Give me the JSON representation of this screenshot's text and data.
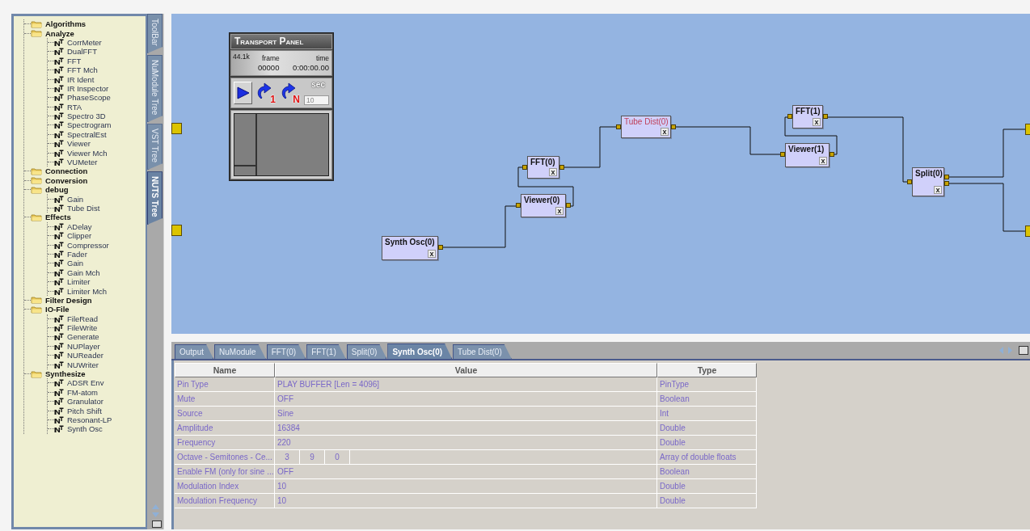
{
  "tool_tabs": [
    {
      "label": "ToolBar",
      "selected": false
    },
    {
      "label": "NuModule Tree",
      "selected": false
    },
    {
      "label": "VST Tree",
      "selected": false
    },
    {
      "label": "NUTS Tree",
      "selected": true
    }
  ],
  "module_tree": [
    {
      "label": "Algorithms",
      "kind": "folder"
    },
    {
      "label": "Analyze",
      "kind": "folder",
      "children": [
        {
          "label": "CorrMeter",
          "kind": "module"
        },
        {
          "label": "DualFFT",
          "kind": "module"
        },
        {
          "label": "FFT",
          "kind": "module"
        },
        {
          "label": "FFT Mch",
          "kind": "module"
        },
        {
          "label": "IR Ident",
          "kind": "module"
        },
        {
          "label": "IR Inspector",
          "kind": "module"
        },
        {
          "label": "PhaseScope",
          "kind": "module"
        },
        {
          "label": "RTA",
          "kind": "module"
        },
        {
          "label": "Spectro 3D",
          "kind": "module"
        },
        {
          "label": "Spectrogram",
          "kind": "module"
        },
        {
          "label": "SpectralEst",
          "kind": "module"
        },
        {
          "label": "Viewer",
          "kind": "module"
        },
        {
          "label": "Viewer Mch",
          "kind": "module"
        },
        {
          "label": "VUMeter",
          "kind": "module"
        }
      ]
    },
    {
      "label": "Connection",
      "kind": "folder"
    },
    {
      "label": "Conversion",
      "kind": "folder"
    },
    {
      "label": "debug",
      "kind": "folder",
      "children": [
        {
          "label": "Gain",
          "kind": "module"
        },
        {
          "label": "Tube Dist",
          "kind": "module"
        }
      ]
    },
    {
      "label": "Effects",
      "kind": "folder",
      "children": [
        {
          "label": "ADelay",
          "kind": "module"
        },
        {
          "label": "Clipper",
          "kind": "module"
        },
        {
          "label": "Compressor",
          "kind": "module"
        },
        {
          "label": "Fader",
          "kind": "module"
        },
        {
          "label": "Gain",
          "kind": "module"
        },
        {
          "label": "Gain Mch",
          "kind": "module"
        },
        {
          "label": "Limiter",
          "kind": "module"
        },
        {
          "label": "Limiter Mch",
          "kind": "module"
        }
      ]
    },
    {
      "label": "Filter Design",
      "kind": "folder"
    },
    {
      "label": "IO-File",
      "kind": "folder",
      "children": [
        {
          "label": "FileRead",
          "kind": "module"
        },
        {
          "label": "FileWrite",
          "kind": "module"
        },
        {
          "label": "Generate",
          "kind": "module"
        },
        {
          "label": "NUPlayer",
          "kind": "module"
        },
        {
          "label": "NUReader",
          "kind": "module"
        },
        {
          "label": "NUWriter",
          "kind": "module"
        }
      ]
    },
    {
      "label": "Synthesize",
      "kind": "folder",
      "children": [
        {
          "label": "ADSR Env",
          "kind": "module"
        },
        {
          "label": "FM-atom",
          "kind": "module"
        },
        {
          "label": "Granulator",
          "kind": "module"
        },
        {
          "label": "Pitch Shift",
          "kind": "module"
        },
        {
          "label": "Resonant-LP",
          "kind": "module"
        },
        {
          "label": "Synth Osc",
          "kind": "module"
        }
      ]
    }
  ],
  "transport_panel": {
    "title": "Transport Panel",
    "sample_rate": "44.1k",
    "frame_label": "frame",
    "frame": "00000",
    "time_label": "time",
    "time": "0:00:00.00",
    "buttons": [
      {
        "kind": "play"
      },
      {
        "kind": "loop",
        "badge": "1"
      },
      {
        "kind": "loop",
        "badge": "N"
      }
    ],
    "duration_label": "sec",
    "duration": "10"
  },
  "nodes": [
    {
      "label": "Tube Dist(0)",
      "highlighted": true,
      "close": "x"
    },
    {
      "label": "FFT(1)",
      "highlighted": false,
      "close": "x"
    },
    {
      "label": "Viewer(1)",
      "highlighted": false,
      "close": "x"
    },
    {
      "label": "FFT(0)",
      "highlighted": false,
      "close": "x"
    },
    {
      "label": "Split(0)",
      "highlighted": false,
      "close": "x"
    },
    {
      "label": "Viewer(0)",
      "highlighted": false,
      "close": "x"
    },
    {
      "label": "Synth Osc(0)",
      "highlighted": false,
      "close": "x"
    }
  ],
  "property_tabs": [
    {
      "label": "Output",
      "selected": false
    },
    {
      "label": "NuModule",
      "selected": false
    },
    {
      "label": "FFT(0)",
      "selected": false
    },
    {
      "label": "FFT(1)",
      "selected": false
    },
    {
      "label": "Split(0)",
      "selected": false
    },
    {
      "label": "Synth Osc(0)",
      "selected": true
    },
    {
      "label": "Tube Dist(0)",
      "selected": false
    }
  ],
  "property_table": {
    "columns": [
      "Name",
      "Value",
      "Type"
    ],
    "rows": [
      {
        "name": "Pin Type",
        "kind": "text",
        "value": "PLAY BUFFER [Len = 4096]",
        "type": "PinType"
      },
      {
        "name": "Mute",
        "kind": "text",
        "value": "OFF",
        "type": "Boolean"
      },
      {
        "name": "Source",
        "kind": "text",
        "value": "Sine",
        "type": "Int"
      },
      {
        "name": "Amplitude",
        "kind": "text",
        "value": "16384",
        "type": "Double"
      },
      {
        "name": "Frequency",
        "kind": "text",
        "value": "220",
        "type": "Double"
      },
      {
        "name": "Octave - Semitones - Ce...",
        "kind": "array",
        "values": [
          "3",
          "9",
          "0"
        ],
        "type": "Array of double floats"
      },
      {
        "name": "Enable FM (only for sine ...",
        "kind": "text",
        "value": "OFF",
        "type": "Boolean"
      },
      {
        "name": "Modulation Index",
        "kind": "text",
        "value": "10",
        "type": "Double"
      },
      {
        "name": "Modulation Frequency",
        "kind": "text",
        "value": "10",
        "type": "Double"
      }
    ]
  }
}
